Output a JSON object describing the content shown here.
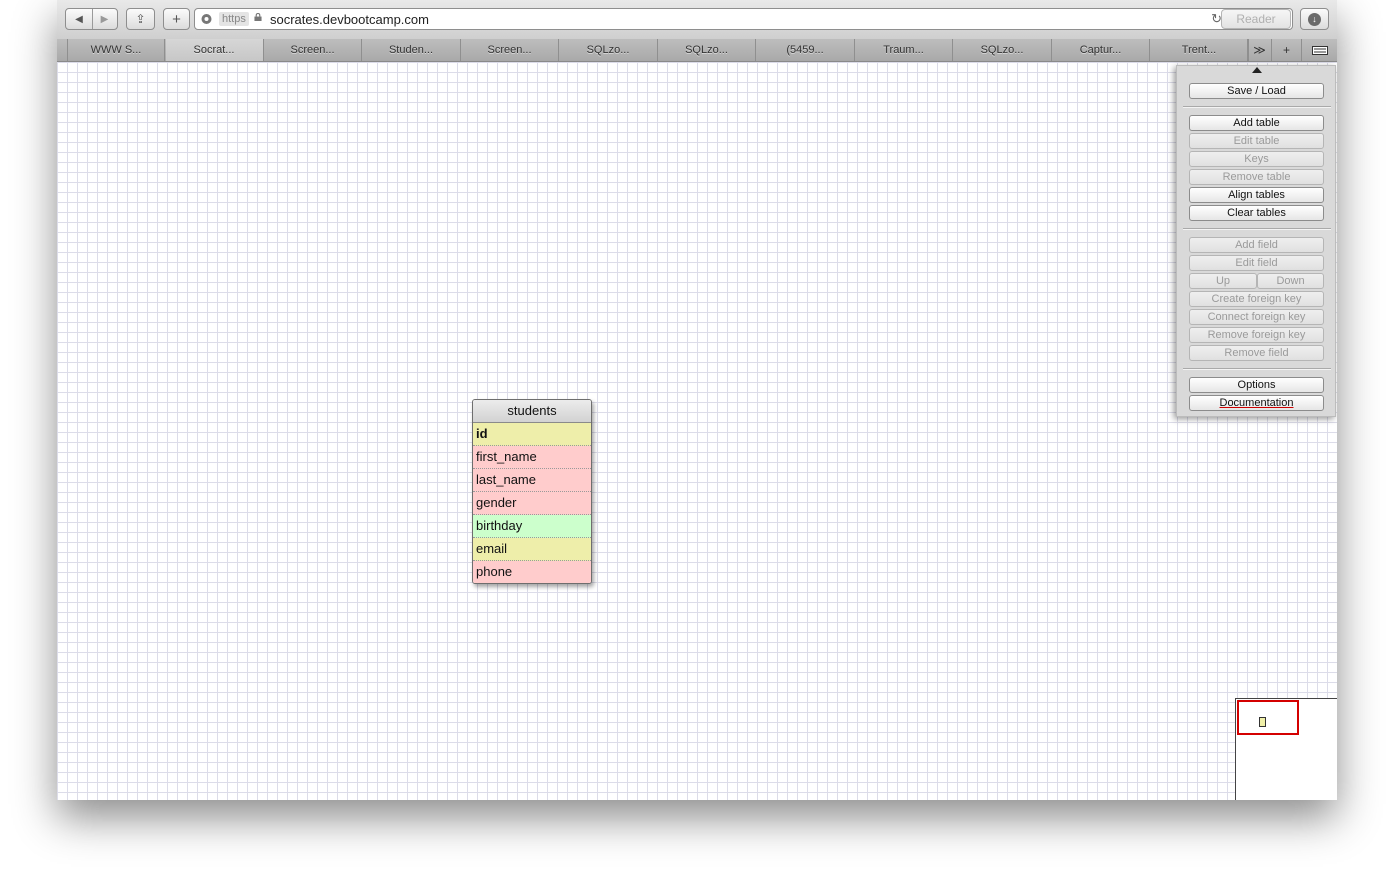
{
  "browser": {
    "url_scheme": "https",
    "url": "socrates.devbootcamp.com",
    "reader_label": "Reader",
    "back_glyph": "◀",
    "forward_glyph": "▶",
    "share_glyph": "⇪",
    "add_glyph": "+",
    "reload_glyph": "↻",
    "download_glyph": "↓",
    "tabs_overflow_glyph": "≫",
    "new_tab_glyph": "+",
    "icons": [
      "back-icon",
      "forward-icon",
      "share-icon",
      "add-bookmark-icon",
      "lock-icon",
      "reload-icon",
      "download-icon",
      "new-tab-icon",
      "tab-overflow-icon",
      "sidebar-icon"
    ]
  },
  "tabs": [
    {
      "label": "WWW S..."
    },
    {
      "label": "Socrat...",
      "active": true
    },
    {
      "label": "Screen..."
    },
    {
      "label": "Studen..."
    },
    {
      "label": "Screen..."
    },
    {
      "label": "SQLzo..."
    },
    {
      "label": "SQLzo..."
    },
    {
      "label": "(5459..."
    },
    {
      "label": "Traum..."
    },
    {
      "label": "SQLzo..."
    },
    {
      "label": "Captur..."
    },
    {
      "label": "Trent..."
    }
  ],
  "panel": {
    "save_load": "Save / Load",
    "add_table": "Add table",
    "edit_table": "Edit table",
    "keys": "Keys",
    "remove_table": "Remove table",
    "align_tables": "Align tables",
    "clear_tables": "Clear tables",
    "add_field": "Add field",
    "edit_field": "Edit field",
    "up": "Up",
    "down": "Down",
    "create_foreign_key": "Create foreign key",
    "connect_foreign_key": "Connect foreign key",
    "remove_foreign_key": "Remove foreign key",
    "remove_field": "Remove field",
    "options": "Options",
    "documentation": "Documentation"
  },
  "db_table": {
    "name": "students",
    "fields": [
      {
        "name": "id",
        "color": "#eeeeaa",
        "primary": true
      },
      {
        "name": "first_name",
        "color": "#ffcccc"
      },
      {
        "name": "last_name",
        "color": "#ffcccc"
      },
      {
        "name": "gender",
        "color": "#ffcccc"
      },
      {
        "name": "birthday",
        "color": "#ccffcc"
      },
      {
        "name": "email",
        "color": "#eeeeaa"
      },
      {
        "name": "phone",
        "color": "#ffcccc"
      }
    ]
  },
  "colors": {
    "minimap_view": "#d40000",
    "grid": "#dcdce9"
  }
}
